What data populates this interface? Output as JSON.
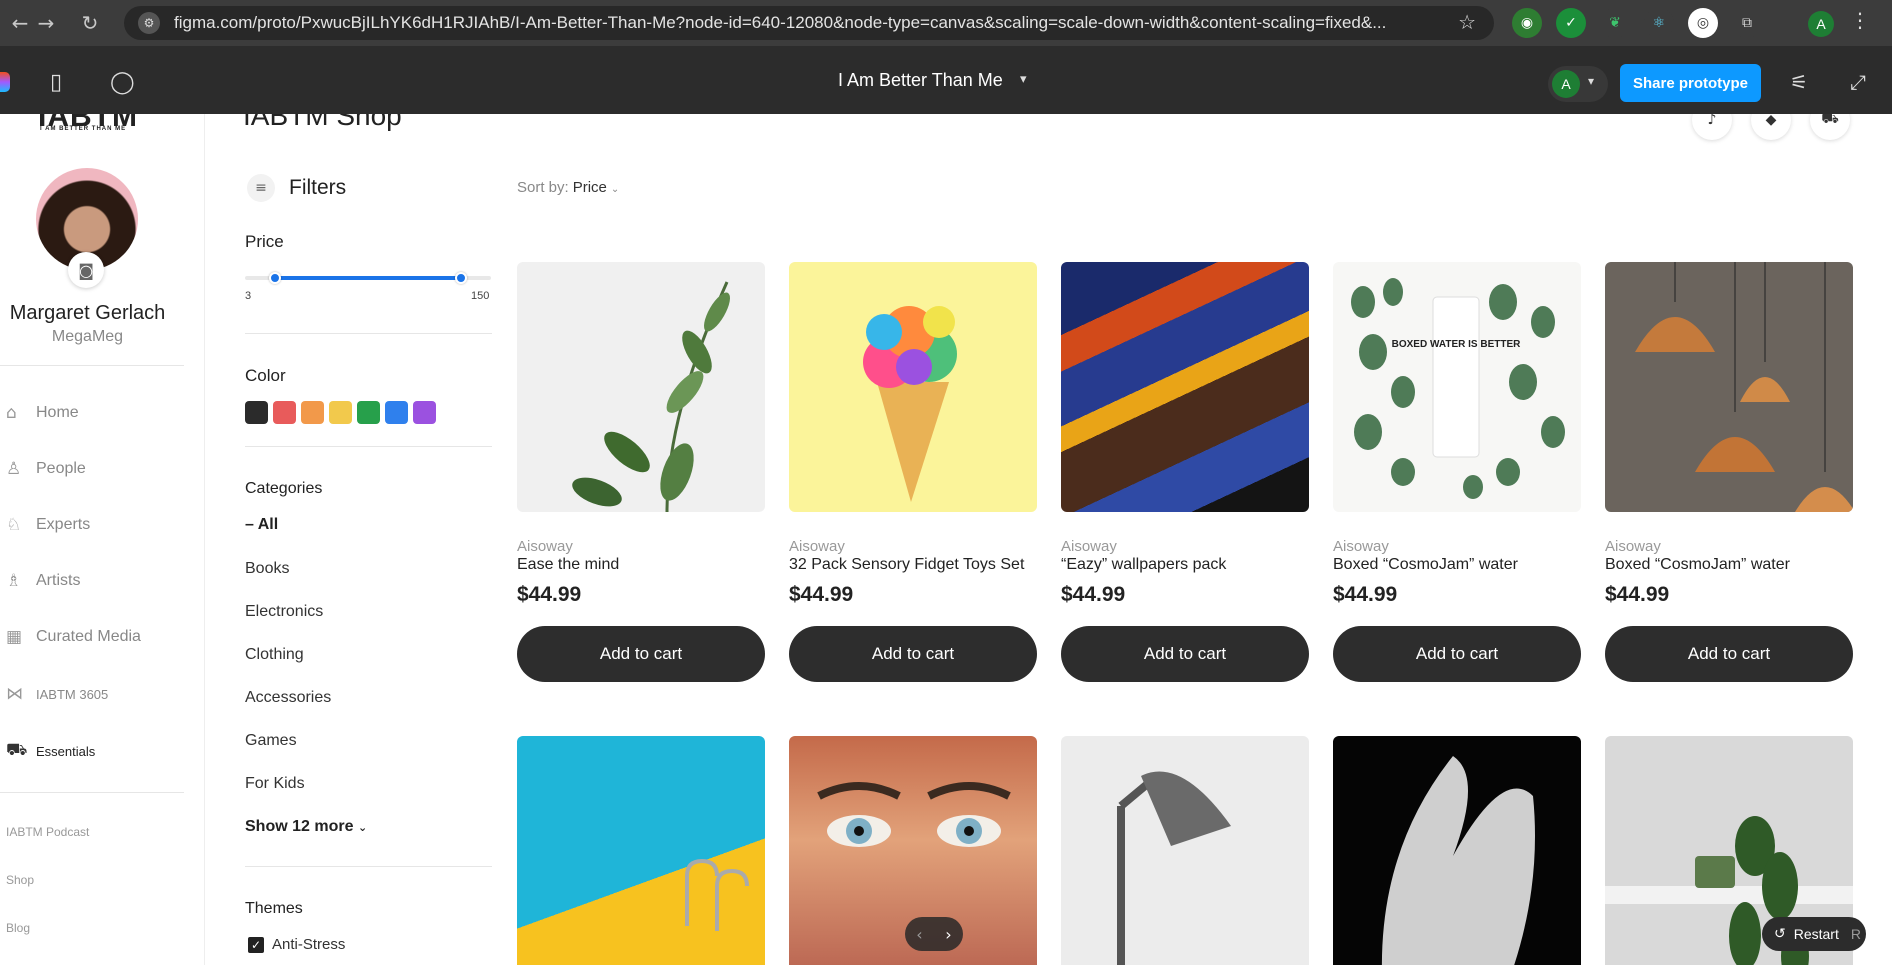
{
  "browser": {
    "url": "figma.com/proto/PxwucBjILhYK6dH1RJIAhB/I-Am-Better-Than-Me?node-id=640-12080&node-type=canvas&scaling=scale-down-width&content-scaling=fixed&...",
    "profile_initial": "A"
  },
  "figma": {
    "file_title": "I Am Better Than Me",
    "user_initial": "A",
    "share_label": "Share prototype"
  },
  "sidebar": {
    "logo": "IABTM",
    "logo_sub": "I AM BETTER THAN ME",
    "user_name": "Margaret Gerlach",
    "user_handle": "MegaMeg",
    "items": [
      {
        "label": "Home",
        "icon": "home-icon"
      },
      {
        "label": "People",
        "icon": "people-icon"
      },
      {
        "label": "Experts",
        "icon": "experts-icon"
      },
      {
        "label": "Artists",
        "icon": "artists-icon"
      },
      {
        "label": "Curated Media",
        "icon": "media-icon"
      },
      {
        "label": "IABTM 3605",
        "icon": "share-icon"
      },
      {
        "label": "Essentials",
        "icon": "cart-icon"
      }
    ],
    "footer_links": [
      "IABTM Podcast",
      "Shop",
      "Blog"
    ]
  },
  "page": {
    "title": "IABTM Shop"
  },
  "filters": {
    "title": "Filters",
    "price_label": "Price",
    "price_min": "3",
    "price_max": "150",
    "price_range_fraction": [
      0.12,
      0.88
    ],
    "color_label": "Color",
    "colors": [
      "#2b2b2b",
      "#e85b5b",
      "#f2994a",
      "#f2c94c",
      "#27a04b",
      "#2f80ed",
      "#9b51e0"
    ],
    "categories_label": "Categories",
    "categories": [
      "All",
      "Books",
      "Electronics",
      "Clothing",
      "Accessories",
      "Games",
      "For Kids"
    ],
    "all_prefix": "– ",
    "show_more": "Show 12 more",
    "themes_label": "Themes",
    "themes": [
      "Anti-Stress"
    ]
  },
  "sort": {
    "label": "Sort by:",
    "value": "Price"
  },
  "products": [
    {
      "vendor": "Aisoway",
      "name": "Ease the mind",
      "price": "$44.99",
      "cart": "Add to cart"
    },
    {
      "vendor": "Aisoway",
      "name": "32 Pack Sensory Fidget Toys Set",
      "price": "$44.99",
      "cart": "Add to cart"
    },
    {
      "vendor": "Aisoway",
      "name": "“Eazy” wallpapers pack",
      "price": "$44.99",
      "cart": "Add to cart"
    },
    {
      "vendor": "Aisoway",
      "name": "Boxed “CosmoJam” water",
      "price": "$44.99",
      "cart": "Add to cart"
    },
    {
      "vendor": "Aisoway",
      "name": "Boxed “CosmoJam” water",
      "price": "$44.99",
      "cart": "Add to cart"
    }
  ],
  "product_image_text": "BOXED WATER IS BETTER",
  "restart": {
    "label": "Restart",
    "key": "R"
  }
}
